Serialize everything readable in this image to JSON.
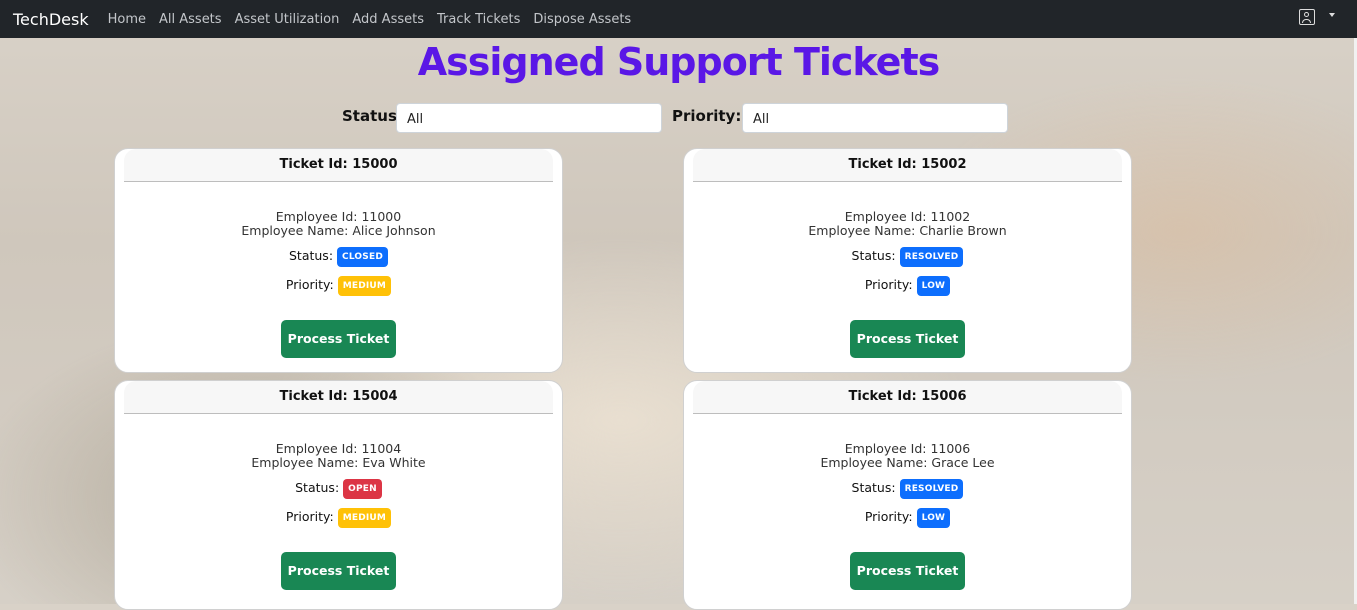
{
  "navbar": {
    "brand": "TechDesk",
    "links": [
      "Home",
      "All Assets",
      "Asset Utilization",
      "Add Assets",
      "Track Tickets",
      "Dispose Assets"
    ]
  },
  "page": {
    "title": "Assigned Support Tickets"
  },
  "filters": {
    "status_label": "Status:",
    "status_value": "All",
    "priority_label": "Priority:",
    "priority_value": "All"
  },
  "labels": {
    "ticket_id_prefix": "Ticket Id: ",
    "employee_id_prefix": "Employee Id: ",
    "employee_name_prefix": "Employee Name: ",
    "status": "Status:",
    "priority": "Priority:",
    "process_button": "Process Ticket"
  },
  "badge_colors": {
    "CLOSED": "#0d6efd",
    "RESOLVED": "#0d6efd",
    "OPEN": "#dc3545",
    "MEDIUM": "#ffc107",
    "LOW": "#0d6efd"
  },
  "tickets": [
    {
      "ticket_id": "15000",
      "employee_id": "11000",
      "employee_name": "Alice Johnson",
      "status": "CLOSED",
      "priority": "MEDIUM"
    },
    {
      "ticket_id": "15002",
      "employee_id": "11002",
      "employee_name": "Charlie Brown",
      "status": "RESOLVED",
      "priority": "LOW"
    },
    {
      "ticket_id": "15004",
      "employee_id": "11004",
      "employee_name": "Eva White",
      "status": "OPEN",
      "priority": "MEDIUM"
    },
    {
      "ticket_id": "15006",
      "employee_id": "11006",
      "employee_name": "Grace Lee",
      "status": "RESOLVED",
      "priority": "LOW"
    }
  ]
}
